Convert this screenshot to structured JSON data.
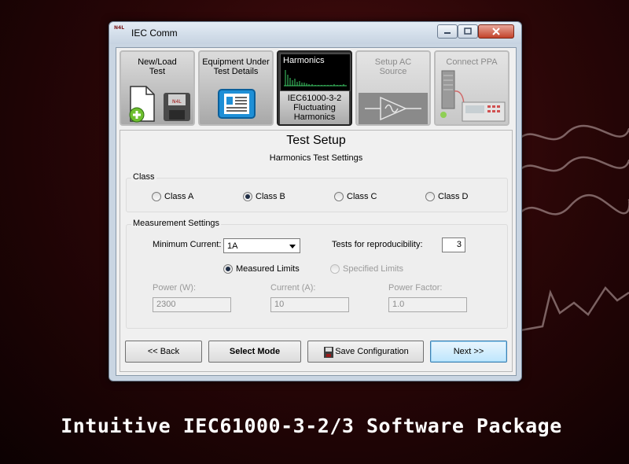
{
  "window": {
    "title": "IEC Comm",
    "logo_text": "N4L"
  },
  "nav": {
    "tiles": [
      {
        "label": "New/Load\nTest"
      },
      {
        "label": "Equipment Under\nTest Details"
      },
      {
        "header": "Harmonics",
        "label": "IEC61000-3-2\nFluctuating\nHarmonics"
      },
      {
        "label": "Setup AC\nSource"
      },
      {
        "label": "Connect PPA"
      }
    ]
  },
  "panel": {
    "title": "Test Setup",
    "subtitle": "Harmonics Test Settings",
    "class_group": {
      "label": "Class",
      "options": [
        "Class A",
        "Class B",
        "Class C",
        "Class D"
      ],
      "selected": "Class B"
    },
    "measurement": {
      "label": "Measurement Settings",
      "min_current_label": "Minimum Current:",
      "min_current_value": "1A",
      "repro_label": "Tests for reproducibility:",
      "repro_value": "3",
      "limits_options": [
        "Measured Limits",
        "Specified Limits"
      ],
      "limits_selected": "Measured Limits",
      "power_label": "Power (W):",
      "power_value": "2300",
      "current_label": "Current (A):",
      "current_value": "10",
      "pf_label": "Power Factor:",
      "pf_value": "1.0"
    }
  },
  "buttons": {
    "back": "<< Back",
    "select_mode": "Select Mode",
    "save": "Save Configuration",
    "next": "Next >>"
  },
  "caption": "Intuitive IEC61000-3-2/3 Software Package",
  "colors": {
    "accent": "#3c7fb1",
    "background": "#2a0607"
  }
}
